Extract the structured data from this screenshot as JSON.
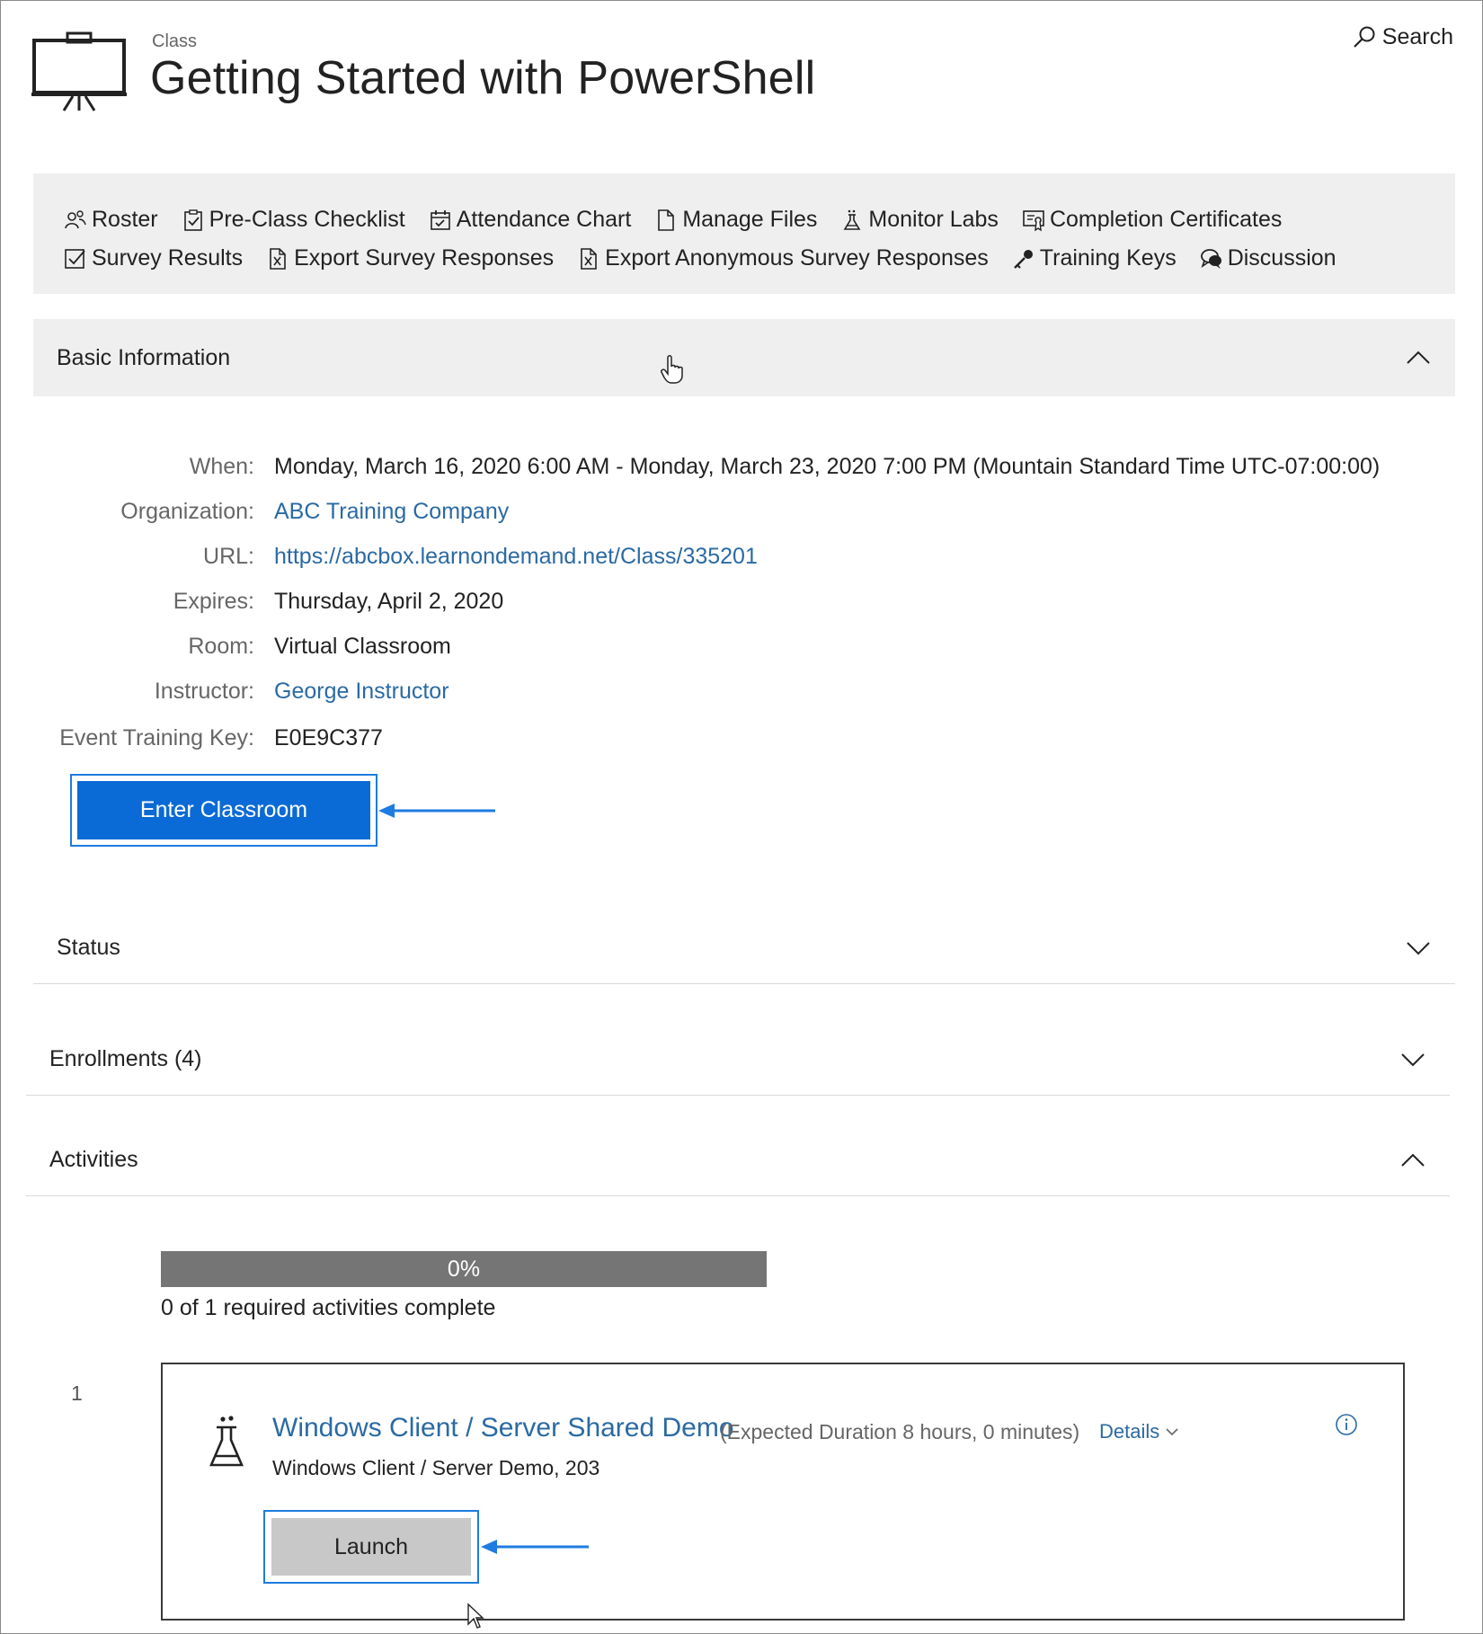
{
  "header": {
    "class_label": "Class",
    "title": "Getting Started with PowerShell",
    "search_label": "Search"
  },
  "toolbar": {
    "row1": [
      {
        "label": "Roster",
        "icon": "roster-icon"
      },
      {
        "label": "Pre-Class Checklist",
        "icon": "checklist-icon"
      },
      {
        "label": "Attendance Chart",
        "icon": "calendar-icon"
      },
      {
        "label": "Manage Files",
        "icon": "file-icon"
      },
      {
        "label": "Monitor Labs",
        "icon": "flask-icon"
      },
      {
        "label": "Completion Certificates",
        "icon": "certificate-icon"
      }
    ],
    "row2": [
      {
        "label": "Survey Results",
        "icon": "checkbox-icon"
      },
      {
        "label": "Export Survey Responses",
        "icon": "excel-icon"
      },
      {
        "label": "Export Anonymous Survey Responses",
        "icon": "excel-icon"
      },
      {
        "label": "Training Keys",
        "icon": "key-icon"
      },
      {
        "label": "Discussion",
        "icon": "chat-icon"
      }
    ]
  },
  "sections": {
    "basic": "Basic Information",
    "status": "Status",
    "enrollments": "Enrollments (4)",
    "activities": "Activities"
  },
  "basic_info": {
    "when_label": "When:",
    "when": "Monday, March 16, 2020 6:00 AM - Monday, March 23, 2020 7:00 PM (Mountain Standard Time UTC-07:00:00)",
    "organization_label": "Organization:",
    "organization": "ABC Training Company",
    "url_label": "URL:",
    "url": "https://abcbox.learnondemand.net/Class/335201",
    "expires_label": "Expires:",
    "expires": "Thursday, April 2, 2020",
    "room_label": "Room:",
    "room": "Virtual Classroom",
    "instructor_label": "Instructor:",
    "instructor": "George Instructor",
    "key_label": "Event Training Key:",
    "key": "E0E9C377",
    "enter_button": "Enter Classroom"
  },
  "activities": {
    "progress_fraction": 0.0,
    "progress_label": "0%",
    "progress_text": "0 of 1 required activities complete",
    "items": [
      {
        "index": "1",
        "title": "Windows Client / Server Shared Demo",
        "duration": "(Expected Duration 8 hours, 0 minutes)",
        "details_label": "Details",
        "subtitle": "Windows Client / Server Demo, 203",
        "launch_label": "Launch"
      }
    ]
  },
  "colors": {
    "link": "#2b6aa3",
    "primary_button": "#0a6bd6",
    "highlight_border": "#1e7be0",
    "panel_bg": "#efefef",
    "progress_bar": "#757575"
  }
}
